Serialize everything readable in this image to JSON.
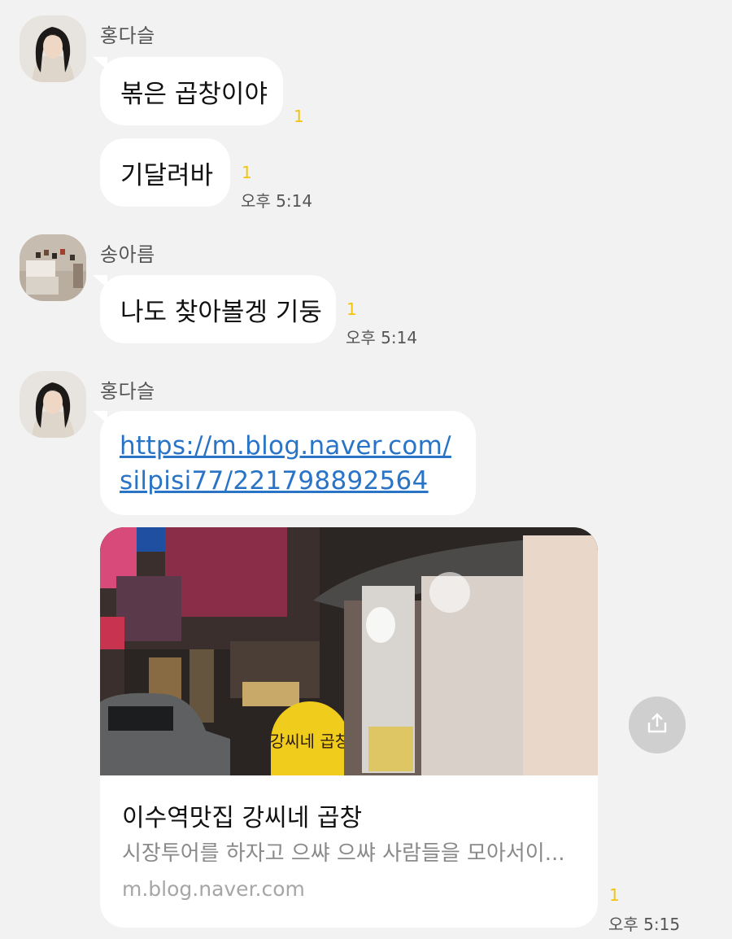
{
  "messages": [
    {
      "sender": "홍다슬",
      "bubbles": [
        {
          "text": "볶은 곱창이야",
          "unread": "1"
        },
        {
          "text": "기달려바",
          "unread": "1",
          "time": "오후 5:14"
        }
      ]
    },
    {
      "sender": "송아름",
      "bubbles": [
        {
          "text": "나도 찾아볼겡 기둥",
          "unread": "1",
          "time": "오후 5:14"
        }
      ]
    },
    {
      "sender": "홍다슬",
      "link": {
        "line1": "https://m.blog.naver.com/",
        "line2": "silpisi77/221798892564"
      },
      "preview": {
        "sign_text": "강씨네 곱창",
        "title": "이수역맛집 강씨네 곱창",
        "description": "시장투어를 하자고 으쌰 으쌰 사람들을 모아서이...",
        "domain": "m.blog.naver.com"
      },
      "unread": "1",
      "time": "오후 5:15"
    }
  ],
  "icons": {
    "share": "share-icon"
  },
  "colors": {
    "background": "#f2f2f2",
    "bubble": "#ffffff",
    "unread": "#f2c40e",
    "link": "#2a74c7"
  }
}
